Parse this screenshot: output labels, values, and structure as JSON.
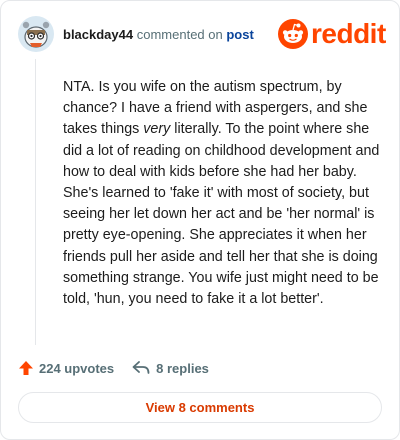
{
  "comment": {
    "username": "blackday44",
    "action_text": "commented on",
    "post_link": "post",
    "body_segments": {
      "part1": "NTA. Is you wife on the autism spectrum, by chance? I have a friend with aspergers, and she takes things ",
      "emphasis": "very",
      "part2": " literally. To the point where she did a lot of reading on childhood development and how to deal with kids before she had her baby. She's learned to 'fake it' with most of society, but seeing her let down her act and be 'her normal' is pretty eye-opening. She appreciates it when her friends pull her aside and tell her that she is doing something strange. You wife just might need to be told, 'hun, you need to fake it a lot better'."
    }
  },
  "brand": {
    "wordmark": "reddit",
    "color": "#ff4500"
  },
  "actions": {
    "upvotes": "224 upvotes",
    "replies": "8 replies"
  },
  "footer": {
    "view_comments": "View 8 comments"
  },
  "icons": {
    "avatar": "snoo-avatar-icon",
    "logo": "reddit-logo-icon",
    "upvote": "upvote-arrow-icon",
    "reply": "reply-arrow-icon"
  }
}
